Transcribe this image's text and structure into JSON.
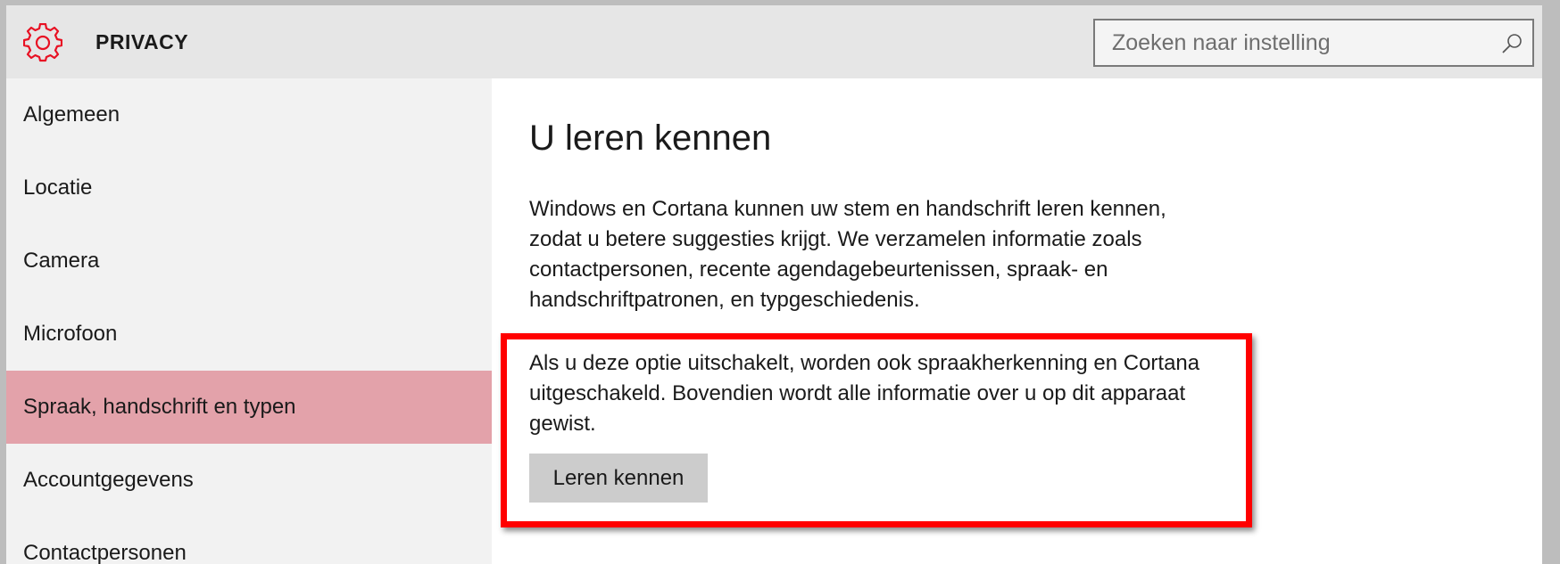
{
  "app": {
    "title": "PRIVACY",
    "icon": "gear-icon",
    "accent_color": "#e81123"
  },
  "search": {
    "placeholder": "Zoeken naar instelling",
    "value": "",
    "icon": "search-icon"
  },
  "sidebar": {
    "items": [
      {
        "label": "Algemeen",
        "active": false
      },
      {
        "label": "Locatie",
        "active": false
      },
      {
        "label": "Camera",
        "active": false
      },
      {
        "label": "Microfoon",
        "active": false
      },
      {
        "label": "Spraak, handschrift en typen",
        "active": true
      },
      {
        "label": "Accountgegevens",
        "active": false
      },
      {
        "label": "Contactpersonen",
        "active": false
      }
    ],
    "active_color": "#e3a2aa"
  },
  "main": {
    "title": "U leren kennen",
    "description": "Windows en Cortana kunnen uw stem en handschrift leren kennen, zodat u betere suggesties krijgt. We verzamelen informatie zoals contactpersonen, recente agendagebeurtenissen, spraak- en handschriftpatronen, en typgeschiedenis.",
    "warning": "Als u deze optie uitschakelt, worden ook spraakherkenning en Cortana uitgeschakeld. Bovendien wordt alle informatie over u op dit apparaat gewist.",
    "button_label": "Leren kennen",
    "highlight_color": "#ff0000"
  }
}
